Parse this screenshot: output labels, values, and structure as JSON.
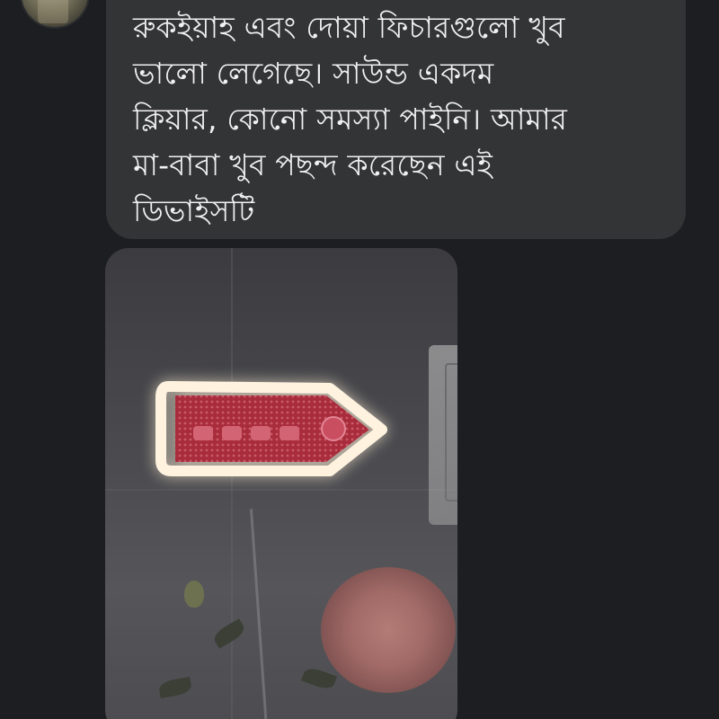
{
  "message": {
    "lines": [
      "রুকইয়াহ এবং দোয়া ফিচারগুলো খুব",
      "ভালো লেগেছে। সাউন্ড একদম",
      "ক্লিয়ার, কোনো সমস্যা পাইনি। আমার",
      "মা-বাবা খুব পছন্দ করেছেন এই",
      "ডিভাইসটি"
    ]
  },
  "colors": {
    "background": "#1d1e21",
    "bubble": "#333436",
    "text": "#f1f1f1",
    "device_body": "#a82c3c",
    "device_glow": "#fff3e0"
  },
  "icons": {
    "avatar": "user-avatar-photo"
  }
}
